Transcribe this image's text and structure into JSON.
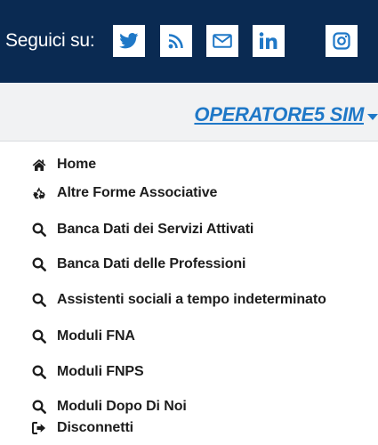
{
  "header": {
    "follow_label": "Seguici su:",
    "accent_color": "#0a2a52",
    "social_links": [
      {
        "name": "twitter-icon",
        "color": "#1f78c7"
      },
      {
        "name": "rss-icon",
        "color": "#1f78c7"
      },
      {
        "name": "mail-icon",
        "color": "#1f78c7"
      },
      {
        "name": "linkedin-icon",
        "color": "#1f78c7"
      },
      {
        "name": "instagram-icon",
        "color": "#1f78c7"
      }
    ]
  },
  "user_bar": {
    "username": "OPERATORE5 SIM",
    "link_color": "#1f78c7"
  },
  "menu": {
    "items": [
      {
        "label": "Home",
        "icon": "home-icon"
      },
      {
        "label": "Altre Forme Associative",
        "icon": "recycle-icon"
      },
      {
        "label": "Banca Dati dei Servizi Attivati",
        "icon": "search-icon"
      },
      {
        "label": "Banca Dati delle Professioni",
        "icon": "search-icon"
      },
      {
        "label": "Assistenti sociali a tempo indeterminato",
        "icon": "search-icon"
      },
      {
        "label": "Moduli FNA",
        "icon": "search-icon"
      },
      {
        "label": "Moduli FNPS",
        "icon": "search-icon"
      },
      {
        "label": "Moduli Dopo Di Noi",
        "icon": "search-icon"
      },
      {
        "label": "Disconnetti",
        "icon": "sign-out-icon"
      }
    ]
  }
}
